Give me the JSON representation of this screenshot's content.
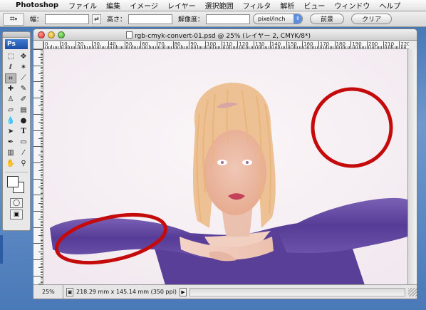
{
  "menubar": {
    "app_name": "Photoshop",
    "items": [
      "ファイル",
      "編集",
      "イメージ",
      "レイヤー",
      "選択範囲",
      "フィルタ",
      "解析",
      "ビュー",
      "ウィンドウ",
      "ヘルプ"
    ]
  },
  "options": {
    "width_label": "幅：",
    "width_value": "",
    "height_label": "高さ：",
    "height_value": "",
    "resolution_label": "解像度：",
    "resolution_value": "",
    "unit_select": "pixel/inch",
    "front_image_button": "前景",
    "clear_button": "クリア"
  },
  "toolbox": {
    "logo": "Ps",
    "tools": [
      "marquee-tool",
      "move-tool",
      "lasso-tool",
      "magic-wand-tool",
      "crop-tool",
      "slice-tool",
      "healing-brush-tool",
      "brush-tool",
      "clone-stamp-tool",
      "history-brush-tool",
      "eraser-tool",
      "gradient-tool",
      "blur-tool",
      "dodge-tool",
      "path-selection-tool",
      "type-tool",
      "pen-tool",
      "shape-tool",
      "notes-tool",
      "eyedropper-tool",
      "hand-tool",
      "zoom-tool"
    ],
    "type_glyph": "T"
  },
  "document": {
    "title": "rgb-cmyk-convert-01.psd @ 25% (レイヤー 2, CMYK/8*)",
    "ruler_labels": [
      "0",
      "10",
      "20",
      "30",
      "40",
      "50",
      "60",
      "70",
      "80",
      "90",
      "100",
      "110",
      "120",
      "130",
      "140",
      "150",
      "160",
      "170",
      "180",
      "190",
      "200",
      "210",
      "220"
    ],
    "zoom": "25%",
    "doc_size": "218.29 mm x 145.14 mm (350 ppi)"
  },
  "colors": {
    "circle_stroke": "#c40a0a",
    "shirt": "#5b3f96",
    "background": "#f8f2f6"
  }
}
